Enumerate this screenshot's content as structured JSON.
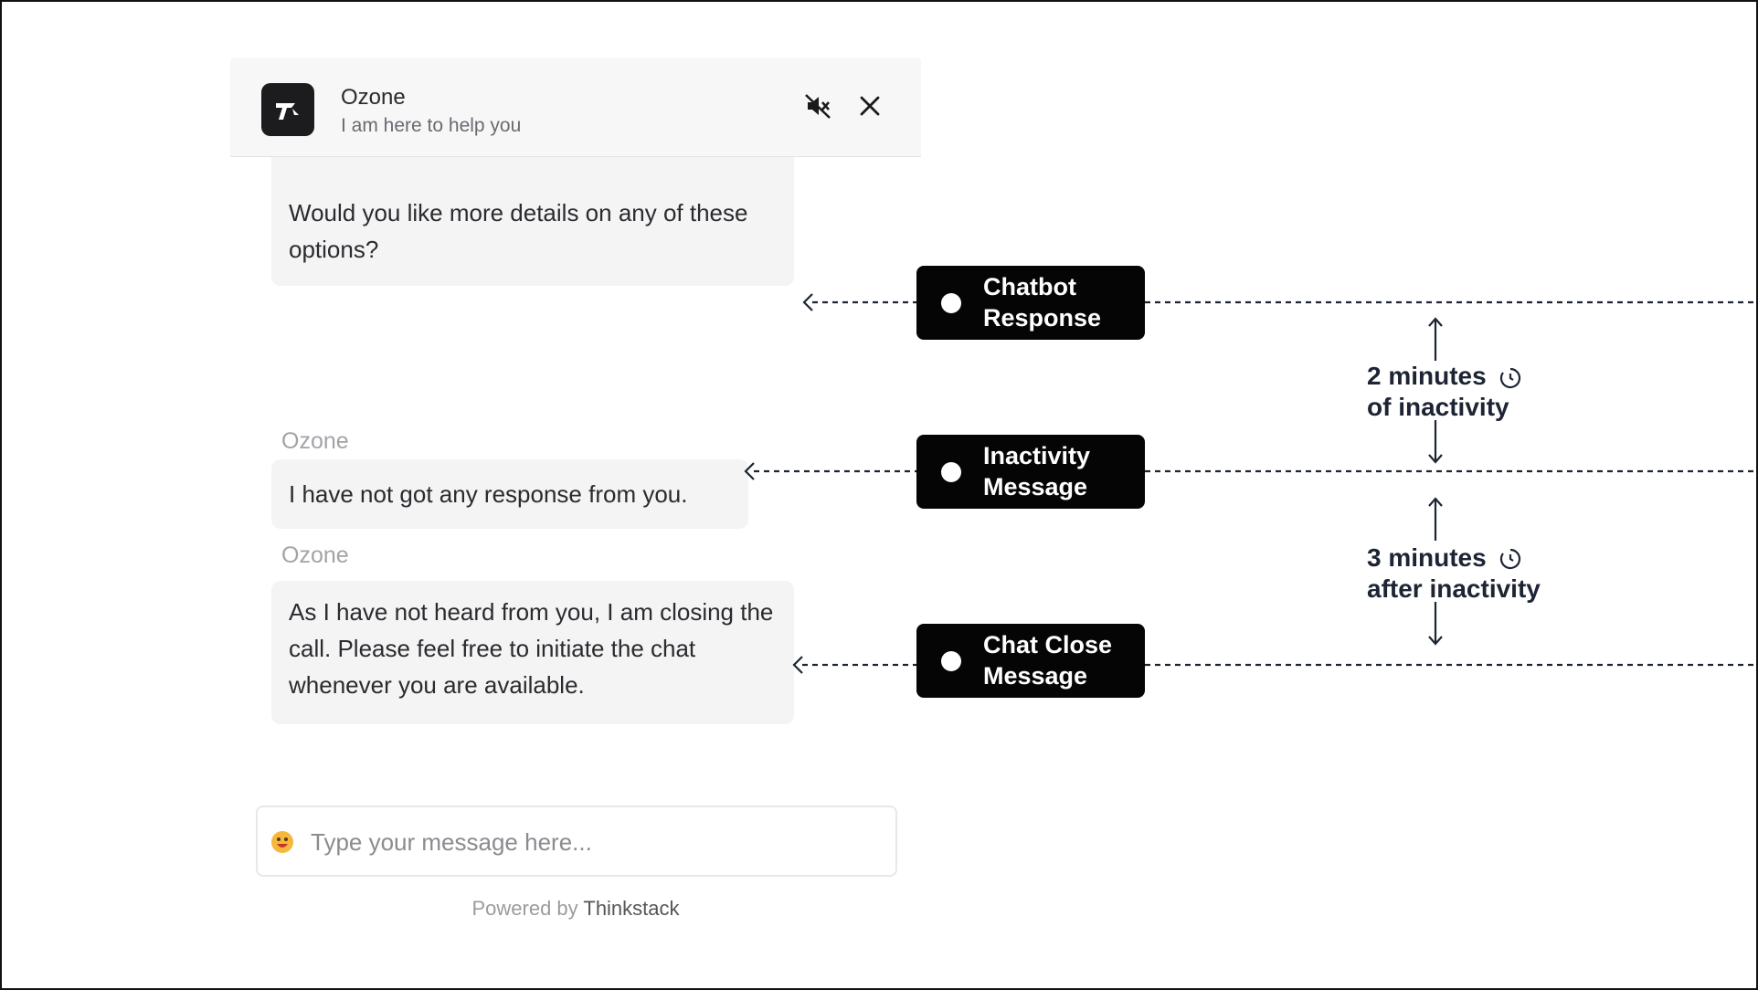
{
  "chat": {
    "bot_name": "Ozone",
    "bot_subtitle": "I am here to help you",
    "messages": [
      {
        "sender": "",
        "text": "Would you like more details on any of these options?"
      },
      {
        "sender": "Ozone",
        "text": "I have not got any response from you."
      },
      {
        "sender": "Ozone",
        "text": "As I have not heard from you, I am closing the call. Please feel free to initiate the chat whenever you are available."
      }
    ],
    "input_placeholder": "Type your message here...",
    "powered_by": "Powered by",
    "brand": "Thinkstack"
  },
  "annotations": {
    "labels": [
      "Chatbot Response",
      "Inactivity Message",
      "Chat Close Message"
    ],
    "intervals": [
      {
        "line1": "2 minutes",
        "line2": "of inactivity"
      },
      {
        "line1": "3 minutes",
        "line2": "after inactivity"
      }
    ]
  },
  "colors": {
    "pill_background": "#050505",
    "annotation_text": "#1d2433",
    "bubble_background": "#f4f4f5"
  },
  "icons": [
    "thinkstack-logo-icon",
    "mute-icon",
    "close-icon",
    "emoji-icon",
    "clock-icon"
  ]
}
